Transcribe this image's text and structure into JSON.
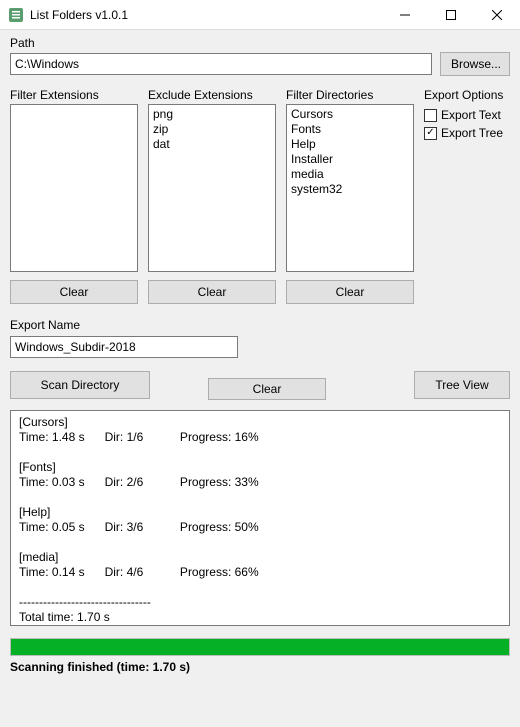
{
  "window": {
    "title": "List Folders v1.0.1"
  },
  "path": {
    "label": "Path",
    "value": "C:\\Windows",
    "browse_label": "Browse..."
  },
  "filter_ext": {
    "label": "Filter Extensions",
    "items": [],
    "clear_label": "Clear"
  },
  "exclude_ext": {
    "label": "Exclude Extensions",
    "items": [
      "png",
      "zip",
      "dat"
    ],
    "clear_label": "Clear"
  },
  "filter_dirs": {
    "label": "Filter Directories",
    "items": [
      "Cursors",
      "Fonts",
      "Help",
      "Installer",
      "media",
      "system32"
    ],
    "clear_label": "Clear"
  },
  "export_opts": {
    "label": "Export Options",
    "text": {
      "label": "Export Text",
      "checked": false
    },
    "tree": {
      "label": "Export Tree",
      "checked": true
    }
  },
  "export_name": {
    "label": "Export Name",
    "value": "Windows_Subdir-2018"
  },
  "actions": {
    "scan_label": "Scan Directory",
    "clear_label": "Clear",
    "tree_label": "Tree View"
  },
  "log_text": "[Cursors]\nTime: 1.48 s      Dir: 1/6           Progress: 16%\n\n[Fonts]\nTime: 0.03 s      Dir: 2/6           Progress: 33%\n\n[Help]\nTime: 0.05 s      Dir: 3/6           Progress: 50%\n\n[media]\nTime: 0.14 s      Dir: 4/6           Progress: 66%\n\n---------------------------------\nTotal time: 1.70 s",
  "progress": {
    "percent": 100
  },
  "status": "Scanning finished (time: 1.70 s)"
}
